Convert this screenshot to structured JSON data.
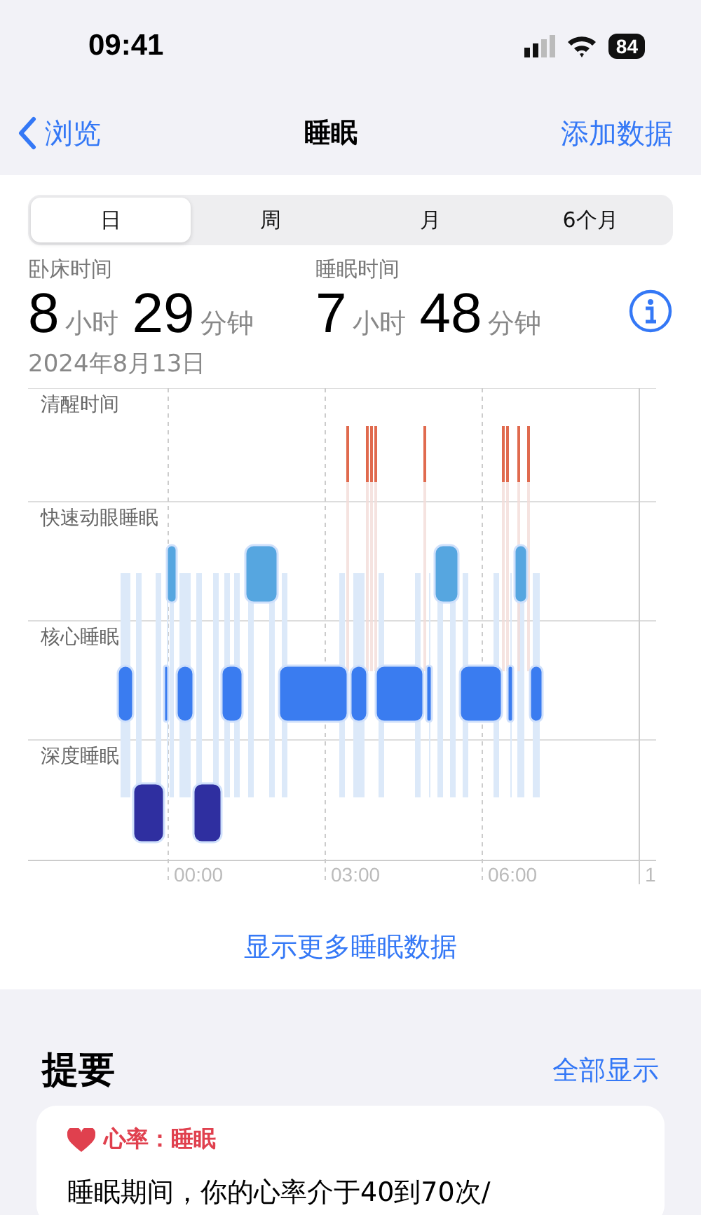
{
  "status_bar": {
    "time": "09:41",
    "battery": "84"
  },
  "nav": {
    "back": "浏览",
    "title": "睡眠",
    "action": "添加数据"
  },
  "tabs": [
    {
      "label": "日",
      "selected": true
    },
    {
      "label": "周",
      "selected": false
    },
    {
      "label": "月",
      "selected": false
    },
    {
      "label": "6个月",
      "selected": false
    }
  ],
  "stats": [
    {
      "label": "卧床时间",
      "hours": "8",
      "hours_unit": "小时",
      "minutes": "29",
      "minutes_unit": "分钟"
    },
    {
      "label": "睡眠时间",
      "hours": "7",
      "hours_unit": "小时",
      "minutes": "48",
      "minutes_unit": "分钟"
    }
  ],
  "date": "2024年8月13日",
  "chart": {
    "stages": [
      "清醒时间",
      "快速动眼睡眠",
      "核心睡眠",
      "深度睡眠"
    ],
    "x_labels": [
      "00:00",
      "03:00",
      "06:00",
      "1"
    ]
  },
  "more_link": "显示更多睡眠数据",
  "summary": {
    "title": "提要",
    "show_all": "全部显示",
    "card": {
      "category": "心率：睡眠",
      "text": "睡眠期间，你的心率介于40到70次/"
    }
  }
}
